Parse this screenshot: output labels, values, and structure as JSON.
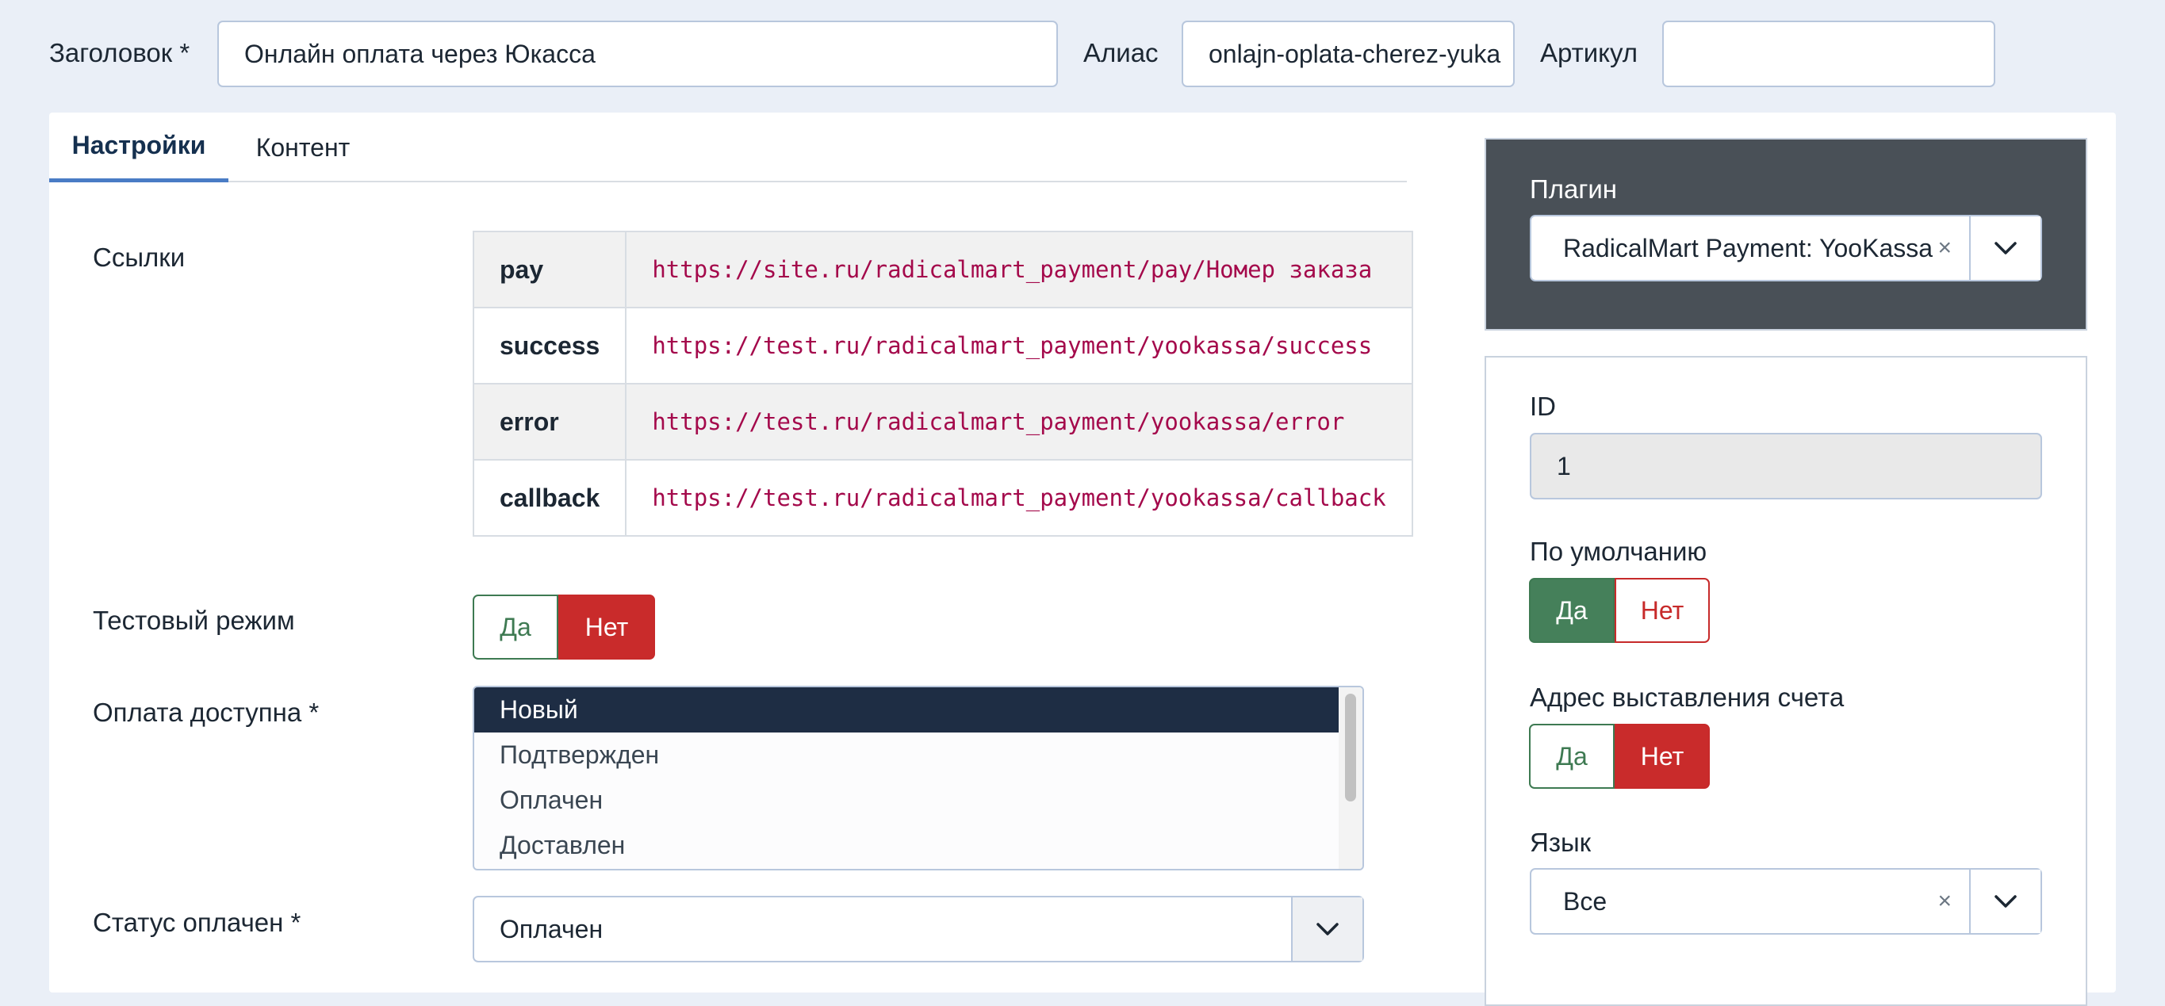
{
  "header": {
    "title_label": "Заголовок *",
    "title_value": "Онлайн оплата через Юкасса",
    "alias_label": "Алиас",
    "alias_value": "onlajn-oplata-cherez-yuka",
    "sku_label": "Артикул",
    "sku_value": ""
  },
  "tabs": [
    {
      "label": "Настройки",
      "active": true
    },
    {
      "label": "Контент",
      "active": false
    }
  ],
  "links": {
    "label": "Ссылки",
    "rows": [
      {
        "key": "pay",
        "url": "https://site.ru/radicalmart_payment/pay/Номер заказа"
      },
      {
        "key": "success",
        "url": "https://test.ru/radicalmart_payment/yookassa/success"
      },
      {
        "key": "error",
        "url": "https://test.ru/radicalmart_payment/yookassa/error"
      },
      {
        "key": "callback",
        "url": "https://test.ru/radicalmart_payment/yookassa/callback"
      }
    ]
  },
  "test_mode": {
    "label": "Тестовый режим",
    "yes": "Да",
    "no": "Нет",
    "selected": "no"
  },
  "payment_available": {
    "label": "Оплата доступна *",
    "options": [
      "Новый",
      "Подтвержден",
      "Оплачен",
      "Доставлен"
    ],
    "selected": "Новый"
  },
  "status_paid": {
    "label": "Статус оплачен *",
    "value": "Оплачен"
  },
  "plugin": {
    "label": "Плагин",
    "value": "RadicalMart Payment: YooKassa",
    "clear": "×"
  },
  "sidebar": {
    "id_label": "ID",
    "id_value": "1",
    "default_label": "По умолчанию",
    "default_yes": "Да",
    "default_no": "Нет",
    "default_selected": "yes",
    "billing_label": "Адрес выставления счета",
    "billing_yes": "Да",
    "billing_no": "Нет",
    "billing_selected": "no",
    "language_label": "Язык",
    "language_value": "Все",
    "clear": "×"
  },
  "colors": {
    "background": "#eaeff7",
    "plugin_panel": "#495057",
    "listbox_selected": "#1e2d44",
    "yes_green": "#45805a",
    "no_red": "#c92b2b",
    "url_text": "#a4094b",
    "tab_accent": "#4a7cc5"
  }
}
